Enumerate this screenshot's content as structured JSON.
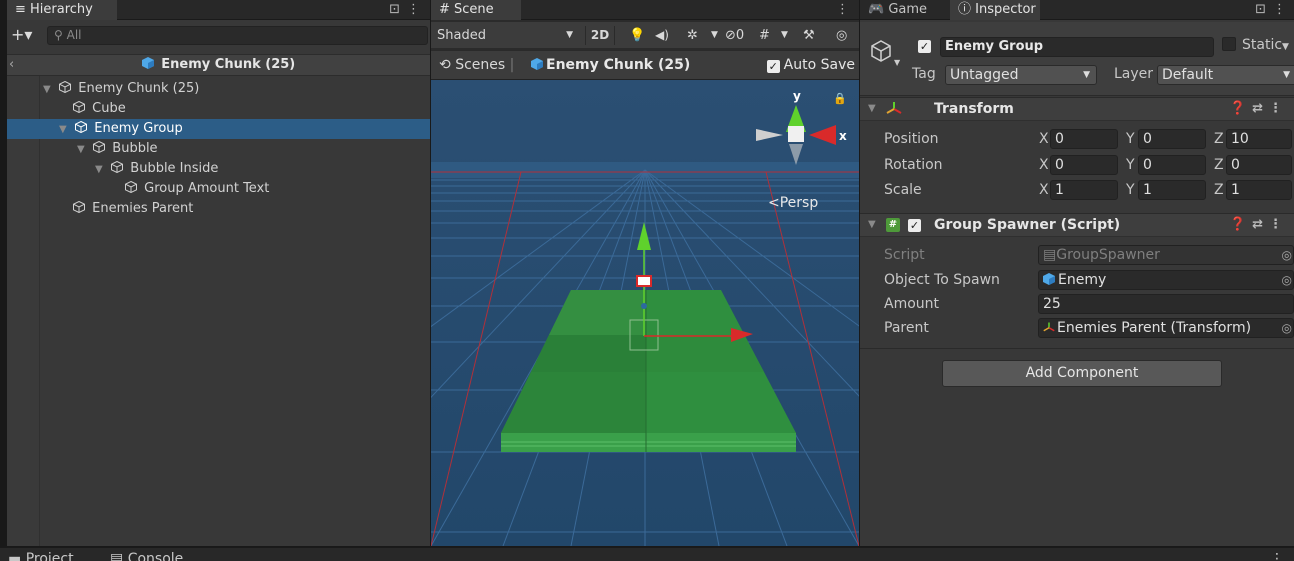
{
  "hierarchy": {
    "tab_label": "Hierarchy",
    "add_label": "+▾",
    "search_placeholder": "All",
    "scene_header": "Enemy Chunk (25)",
    "items": [
      {
        "label": "Enemy Chunk (25)",
        "depth": 0,
        "expanded": true,
        "selected": false
      },
      {
        "label": "Cube",
        "depth": 1,
        "expanded": null,
        "selected": false
      },
      {
        "label": "Enemy Group",
        "depth": 1,
        "expanded": true,
        "selected": true
      },
      {
        "label": "Bubble",
        "depth": 2,
        "expanded": true,
        "selected": false
      },
      {
        "label": "Bubble Inside",
        "depth": 3,
        "expanded": true,
        "selected": false
      },
      {
        "label": "Group Amount Text",
        "depth": 4,
        "expanded": null,
        "selected": false
      },
      {
        "label": "Enemies Parent",
        "depth": 1,
        "expanded": null,
        "selected": false
      }
    ]
  },
  "scene": {
    "tab_label": "Scene",
    "shading_mode": "Shaded",
    "btn_2d": "2D",
    "hidden_count": "0",
    "breadcrumb_root": "Scenes",
    "breadcrumb_prefab": "Enemy Chunk (25)",
    "auto_save_label": "Auto Save",
    "auto_save_checked": true,
    "gizmo_y": "y",
    "gizmo_x": "x",
    "projection_label": "Persp"
  },
  "game": {
    "tab_label": "Game"
  },
  "inspector": {
    "tab_label": "Inspector",
    "object_name": "Enemy Group",
    "active": true,
    "static_label": "Static",
    "tag_label": "Tag",
    "tag_value": "Untagged",
    "layer_label": "Layer",
    "layer_value": "Default",
    "transform": {
      "title": "Transform",
      "position_label": "Position",
      "rotation_label": "Rotation",
      "scale_label": "Scale",
      "position": {
        "x": "0",
        "y": "0",
        "z": "10"
      },
      "rotation": {
        "x": "0",
        "y": "0",
        "z": "0"
      },
      "scale": {
        "x": "1",
        "y": "1",
        "z": "1"
      }
    },
    "group_spawner": {
      "title": "Group Spawner (Script)",
      "enabled": true,
      "script_label": "Script",
      "script_value": "GroupSpawner",
      "object_label": "Object To Spawn",
      "object_value": "Enemy",
      "amount_label": "Amount",
      "amount_value": "25",
      "parent_label": "Parent",
      "parent_value": "Enemies Parent (Transform)"
    },
    "add_component_label": "Add Component"
  },
  "bottom": {
    "project_tab": "Project",
    "console_tab": "Console"
  },
  "colors": {
    "selection": "#2c5d87",
    "panel_bg": "#383838",
    "viewport_sky": "#2a4b6c",
    "green_platform": "#2f8f3f",
    "axis_x": "#d92a2a",
    "axis_y": "#5fd12c",
    "prefab_blue": "#4fa8e8"
  }
}
